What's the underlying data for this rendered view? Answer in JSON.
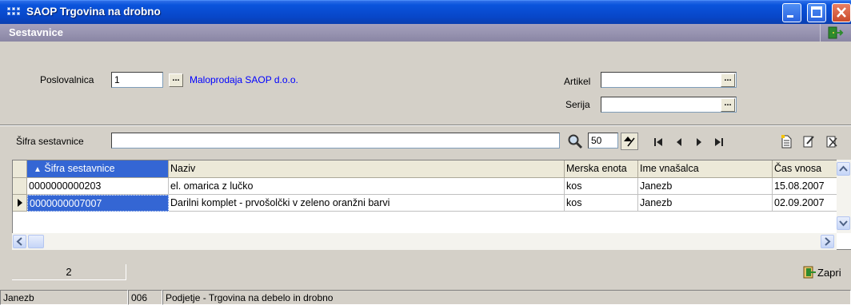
{
  "window": {
    "title": "SAOP Trgovina na drobno",
    "caption": "Sestavnice"
  },
  "filters": {
    "poslovalnica_label": "Poslovalnica",
    "poslovalnica_value": "1",
    "poslovalnica_name": "Maloprodaja SAOP d.o.o.",
    "artikel_label": "Artikel",
    "artikel_value": "",
    "serija_label": "Serija",
    "serija_value": "",
    "ellipsis": "..."
  },
  "search": {
    "label": "Šifra sestavnice",
    "value": "",
    "rows_per_page": "50"
  },
  "table": {
    "columns": [
      "Šifra sestavnice",
      "Naziv",
      "Merska enota",
      "Ime vnašalca",
      "Čas vnosa"
    ],
    "sort_arrow": "▲",
    "rows": [
      [
        "0000000000203",
        "el. omarica z lučko",
        "kos",
        "Janezb",
        "15.08.2007"
      ],
      [
        "0000000007007",
        "Darilni komplet - prvošolčki v zeleno oranžni barvi",
        "kos",
        "Janezb",
        "02.09.2007"
      ]
    ],
    "selected_row": 1
  },
  "footer": {
    "record_count": "2",
    "close_label": "Zapri"
  },
  "statusbar": {
    "user": "Janezb",
    "company_code": "006",
    "company": "Podjetje - Trgovina na debelo in drobno"
  },
  "colors": {
    "titlebar": "#0846c8",
    "caption": "#8a86a4",
    "selection": "#3466d4",
    "link": "#0000ff"
  }
}
